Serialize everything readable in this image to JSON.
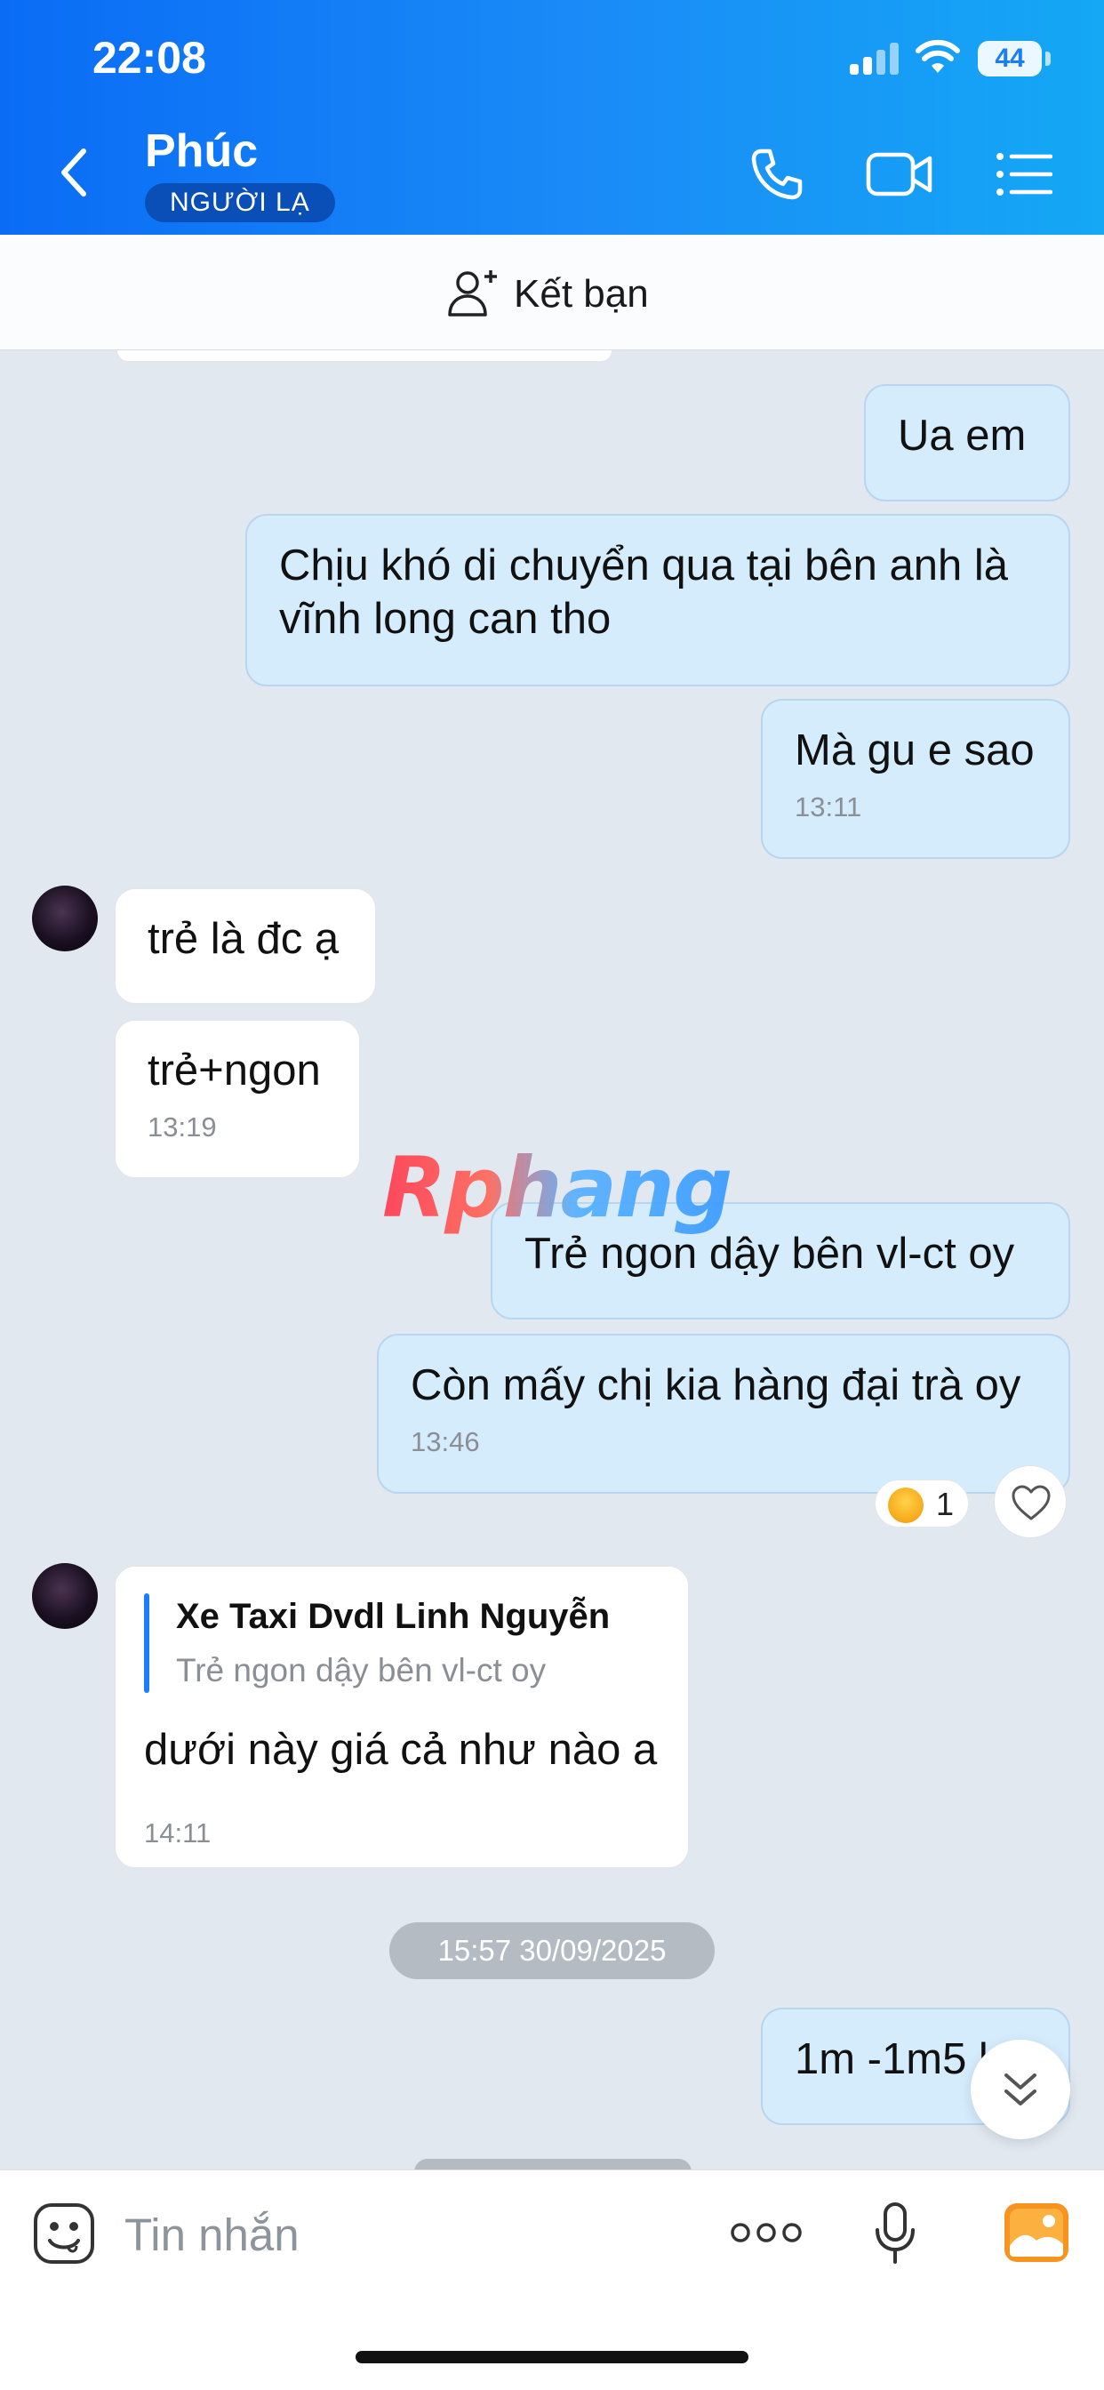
{
  "status_bar": {
    "time": "22:08",
    "battery": "44"
  },
  "header": {
    "name": "Phúc",
    "badge": "NGƯỜI LẠ"
  },
  "friend_bar": {
    "label": "Kết bạn"
  },
  "messages": [
    {
      "text": "Ua em",
      "time": ""
    },
    {
      "text": "Chịu khó di chuyển qua tại bên anh là vĩnh long can tho",
      "time": ""
    },
    {
      "text": "Mà gu e sao",
      "time": "13:11"
    },
    {
      "text": "trẻ là đc ạ",
      "time": ""
    },
    {
      "text": "trẻ+ngon",
      "time": "13:19"
    },
    {
      "text": "Trẻ ngon dậy bên vl-ct oy",
      "time": ""
    },
    {
      "text": "Còn mấy chị kia hàng đại trà oy",
      "time": "13:46"
    },
    {
      "text": "dưới này giá cả như nào a",
      "time": "14:11",
      "quote": {
        "name": "Xe Taxi Dvdl Linh Nguyễn",
        "text": "Trẻ ngon dậy bên vl-ct oy"
      }
    },
    {
      "text": "1m -1m5 k",
      "time": ""
    }
  ],
  "reaction": {
    "count": "1"
  },
  "date_separator": "15:57 30/09/2025",
  "watermark": "Rphang",
  "composer": {
    "placeholder": "Tin nhắn"
  },
  "colors": {
    "header_blue": "#0a6cf5",
    "bubble_out": "#d5ecfd",
    "bubble_in": "#ffffff",
    "background": "#e2e8f0"
  }
}
